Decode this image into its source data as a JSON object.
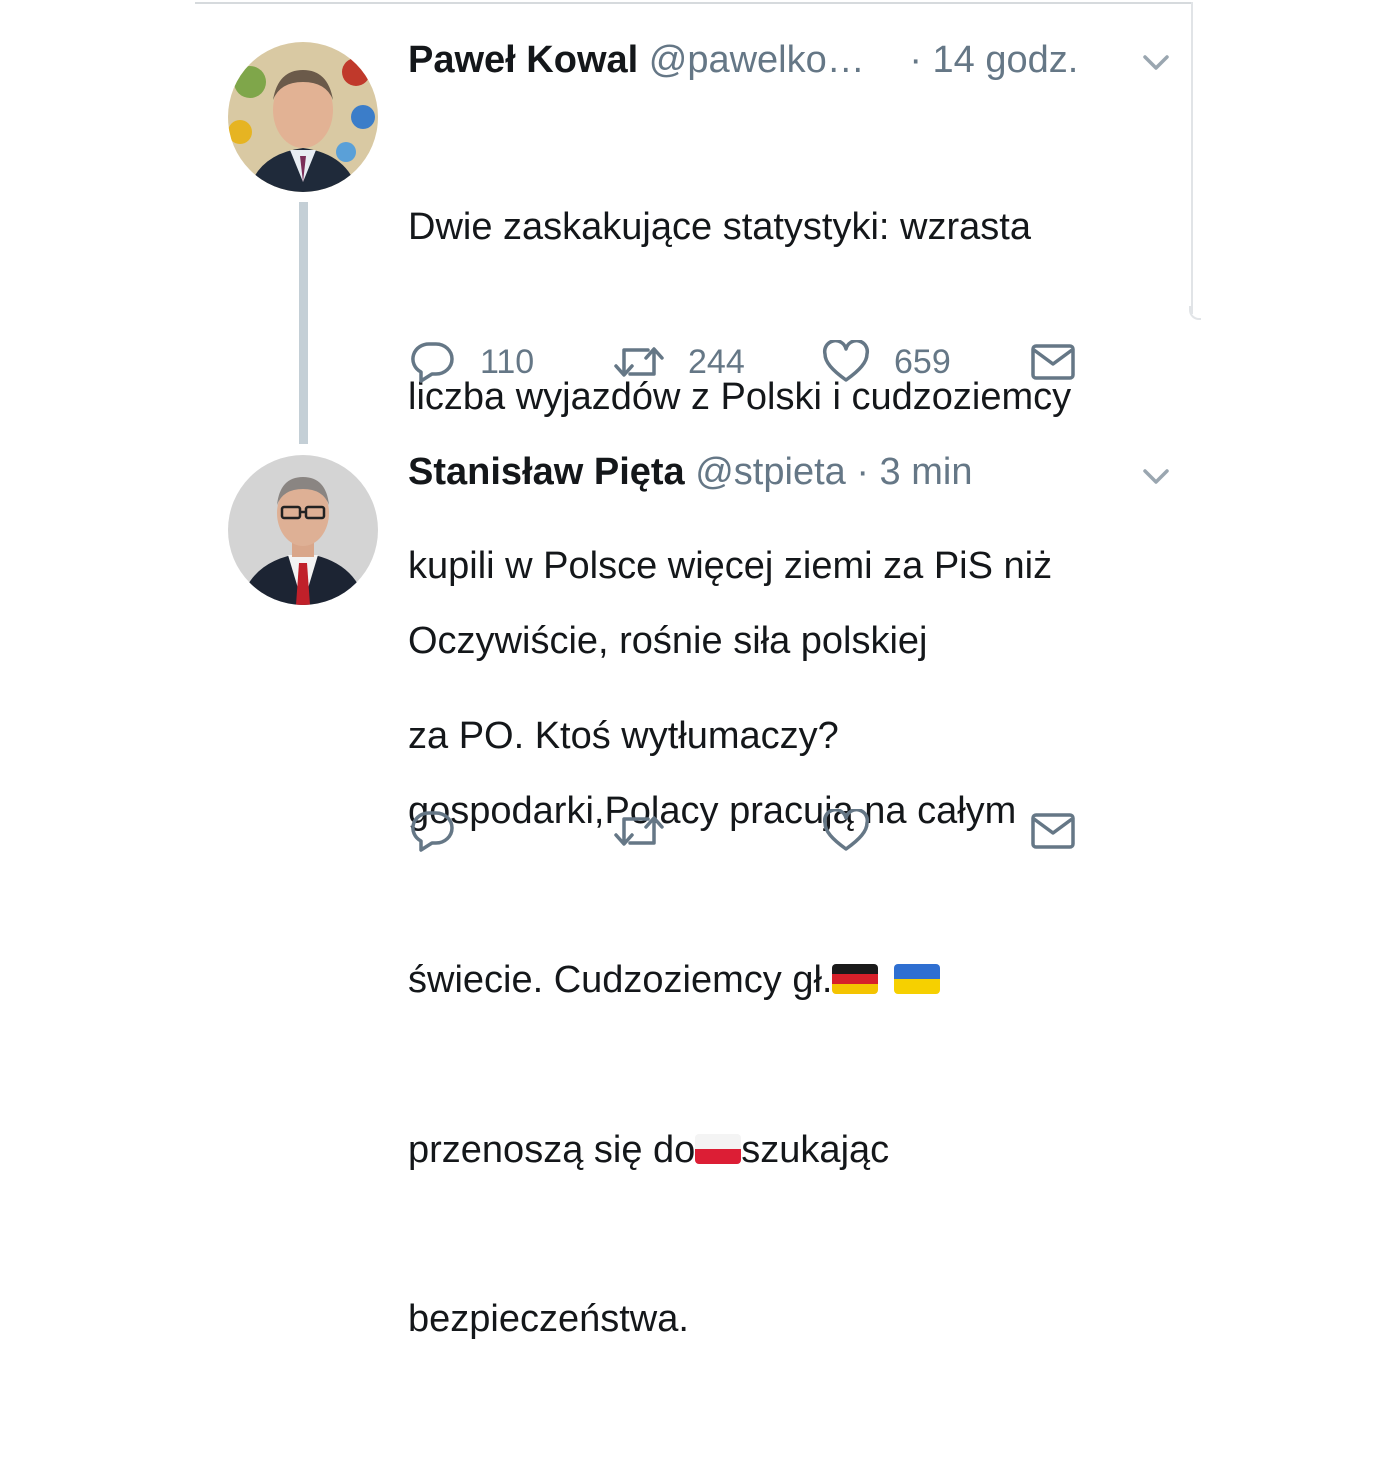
{
  "tweets": [
    {
      "name": "Paweł Kowal",
      "handle": "@pawelko…",
      "time": "· 14 godz.",
      "text_lines": [
        "Dwie zaskakujące statystyki: wzrasta",
        "liczba wyjazdów z Polski i cudzoziemcy",
        "kupili w Polsce więcej ziemi za PiS niż",
        "za PO. Ktoś wytłumaczy?"
      ],
      "counts": {
        "replies": "110",
        "retweets": "244",
        "likes": "659"
      }
    },
    {
      "name": "Stanisław Pięta",
      "handle": "@stpieta",
      "time": "· 3 min",
      "text_lines": [
        "Oczywiście, rośnie siła polskiej",
        "gospodarki,Polacy pracują na całym",
        "świecie. Cudzoziemcy gł.",
        "przenoszą się do",
        "szukając",
        "bezpieczeństwa."
      ],
      "counts": {
        "replies": "",
        "retweets": "",
        "likes": ""
      }
    }
  ],
  "icons": {
    "reply": "reply-icon",
    "retweet": "retweet-icon",
    "like": "heart-icon",
    "dm": "envelope-icon",
    "caret": "chevron-down-icon",
    "flags": [
      "flag-germany-icon",
      "flag-ukraine-icon",
      "flag-poland-icon"
    ]
  },
  "colors": {
    "text": "#14171a",
    "secondary": "#657786",
    "thread_line": "#c4cfd6"
  }
}
